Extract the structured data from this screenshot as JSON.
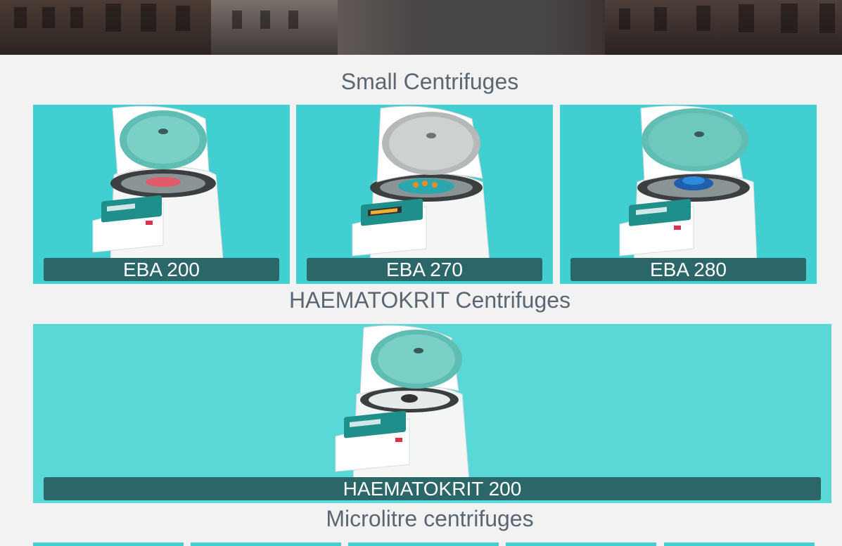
{
  "sections": [
    {
      "title": "Small Centrifuges",
      "products": [
        {
          "name": "EBA 200"
        },
        {
          "name": "EBA 270"
        },
        {
          "name": "EBA 280"
        }
      ]
    },
    {
      "title": "HAEMATOKRIT Centrifuges",
      "products": [
        {
          "name": "HAEMATOKRIT 200"
        }
      ]
    },
    {
      "title": "Microlitre centrifuges"
    }
  ],
  "colors": {
    "card_bg": "#42cfd1",
    "card_bg_wide": "#5ad7d7",
    "caption_bg": "#2b6669",
    "title_text": "#5b6673",
    "page_bg": "#f2f2f2"
  }
}
